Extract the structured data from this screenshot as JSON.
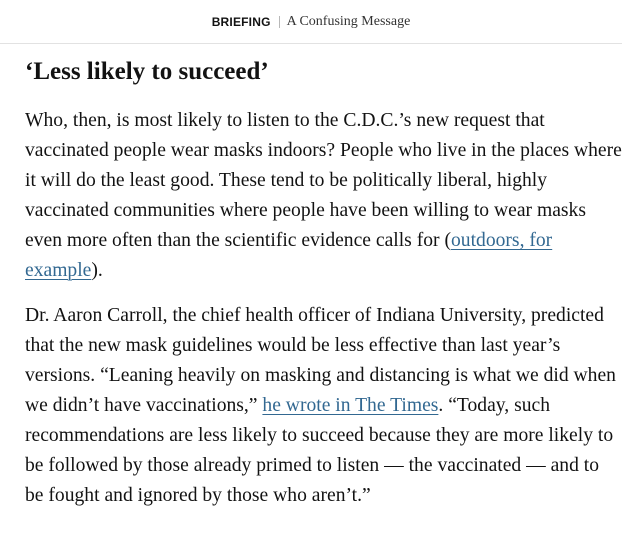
{
  "header": {
    "section": "BRIEFING",
    "topic": "A Confusing Message"
  },
  "article": {
    "heading": "‘Less likely to succeed’",
    "p1": {
      "before_link": "Who, then, is most likely to listen to the C.D.C.’s new request that vaccinated people wear masks indoors? People who live in the places where it will do the least good. These tend to be politically liberal, highly vaccinated communities where people have been willing to wear masks even more often than the scientific evidence calls for (",
      "link": "outdoors, for example",
      "after_link": ")."
    },
    "p2": {
      "before_link": "Dr. Aaron Carroll, the chief health officer of Indiana University, predicted that the new mask guidelines would be less effective than last year’s versions. “Leaning heavily on masking and distancing is what we did when we didn’t have vaccinations,” ",
      "link": "he wrote in The Times",
      "after_link": ". “Today, such recommendations are less likely to succeed because they are more likely to be followed by those already primed to listen — the vaccinated — and to be fought and ignored by those who aren’t.”"
    }
  },
  "colors": {
    "link": "#326891",
    "text": "#121212",
    "rule": "#e2e2e2"
  }
}
